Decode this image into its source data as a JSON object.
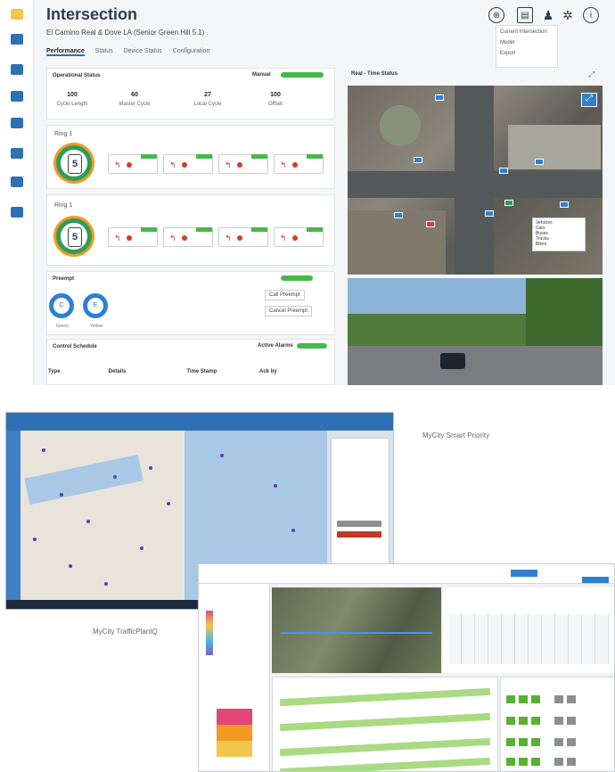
{
  "intersection": {
    "title": "Intersection",
    "subtitle": "El Camino Real & Dove LA (Senior Green Hill 5.1)",
    "header_icons": [
      "back-icon",
      "save-icon",
      "user-icon",
      "gear-icon",
      "info-icon"
    ],
    "dropdown": [
      "Current Intersection",
      "Model",
      "Export"
    ],
    "tabs": [
      "Performance",
      "Status",
      "Device Status",
      "Configuration"
    ],
    "operational": {
      "title": "Operational Status",
      "mode_label": "Manual",
      "stats": [
        {
          "value": "100",
          "label": "Cycle Length"
        },
        {
          "value": "60",
          "label": "Master Cycle"
        },
        {
          "value": "27",
          "label": "Local Cycle"
        },
        {
          "value": "100",
          "label": "Offset"
        }
      ]
    },
    "rings": [
      {
        "label": "Ring 1",
        "number": "5"
      },
      {
        "label": "Ring 1",
        "number": "5"
      }
    ],
    "preempt": {
      "title": "Preempt",
      "buttons": [
        "Call Preempt",
        "Cancel Preempt"
      ],
      "circles": [
        "C",
        "E"
      ],
      "circle_labels": [
        "Green",
        "Yellow"
      ]
    },
    "control": {
      "title": "Control Schedule",
      "right_label": "Active Alarms",
      "columns": [
        "Type",
        "Details",
        "Time Stamp",
        "Ack by"
      ]
    },
    "map": {
      "title": "Real - Time Status",
      "legend": [
        "Vehicles",
        "Cars",
        "Buses",
        "Trucks",
        "Bikes"
      ]
    }
  },
  "smart_priority": {
    "caption": "MyCity Smart Priority"
  },
  "planiq": {
    "caption": "MyCity TrafficPlanIQ"
  },
  "colors": {
    "accent": "#2f6fb3",
    "green": "#47b84a",
    "orange": "#f39a21",
    "red": "#d63a2f"
  }
}
